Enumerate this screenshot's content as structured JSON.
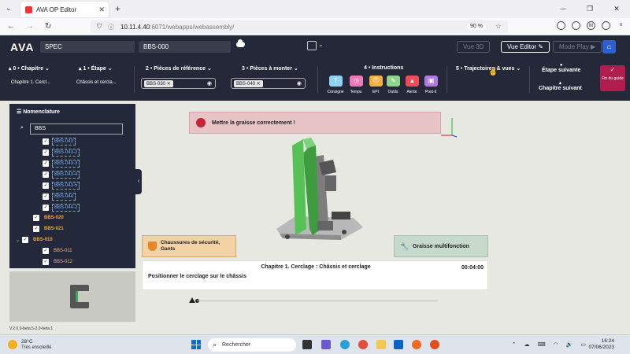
{
  "browser": {
    "tab_title": "AVA OP Editor",
    "url_host": "10.11.4.40",
    "url_rest": ":6071/webapps/webassembly/",
    "zoom": "90 %"
  },
  "app": {
    "logo": "AVA",
    "project_field": "SPEC",
    "assembly_field": "BBS-000",
    "views": {
      "vue3d": "Vue 3D",
      "editor": "Vue Editor",
      "play": "Mode Play"
    }
  },
  "toolbar": {
    "chapitre_label": "0 • Chapitre",
    "chapitre_value": "Chapitre 1. Cercl...",
    "etape_label": "1 • Étape",
    "etape_value": "Châssis et cercla...",
    "ref_label": "2 • Pièces de référence",
    "ref_chip": "BBS-030",
    "mount_label": "3 • Pièces à monter",
    "mount_chip": "BBS-040",
    "instructions_label": "4 • Instructions",
    "instructions": [
      {
        "label": "Consigne",
        "glyph": "T",
        "color": "#8fd3f4"
      },
      {
        "label": "Temps",
        "glyph": "◷",
        "color": "#f07ab8"
      },
      {
        "label": "EPI",
        "glyph": "⛑",
        "color": "#f5b042"
      },
      {
        "label": "Outils",
        "glyph": "✎",
        "color": "#8fd48a"
      },
      {
        "label": "Alerte",
        "glyph": "▲",
        "color": "#f04b5a"
      },
      {
        "label": "Post-it",
        "glyph": "▣",
        "color": "#b07ae0"
      }
    ],
    "traj_label": "5 • Trajectoires & vues",
    "next_step": "Étape suivante",
    "next_chapter": "Chapitre suivant",
    "fin_label": "Fin du guide"
  },
  "nomenclature": {
    "title": "Nomenclature",
    "search": "BBS",
    "items": [
      {
        "label": "BBS-043",
        "indent": 2,
        "style": "blue boxed",
        "check": true
      },
      {
        "label": "BBS-043-2",
        "indent": 2,
        "style": "blue boxed",
        "check": true
      },
      {
        "label": "BBS-043-3",
        "indent": 2,
        "style": "blue boxed",
        "check": true
      },
      {
        "label": "BBS-043-4",
        "indent": 2,
        "style": "blue boxed",
        "check": true
      },
      {
        "label": "BBS-043-5",
        "indent": 2,
        "style": "blue boxed",
        "check": true
      },
      {
        "label": "BBS-044",
        "indent": 2,
        "style": "blue boxed",
        "check": true
      },
      {
        "label": "BBS-044-2",
        "indent": 2,
        "style": "blue boxed",
        "check": true
      },
      {
        "label": "BBS-020",
        "indent": 1,
        "style": "orange",
        "check": true
      },
      {
        "label": "BBS-021",
        "indent": 1,
        "style": "orange",
        "check": true
      },
      {
        "label": "BBS-010",
        "indent": 0,
        "style": "orange",
        "check": true,
        "expander": true
      },
      {
        "label": "BBS-011",
        "indent": 2,
        "style": "lightorange",
        "check": true
      },
      {
        "label": "BBS-012",
        "indent": 2,
        "style": "lightorange",
        "check": true
      }
    ]
  },
  "alert": {
    "text": "Mettre la graisse correctement !"
  },
  "ppe": {
    "text": "Chaussures de sécurité, Gants"
  },
  "tool": {
    "text": "Graisse multifonction"
  },
  "info": {
    "title": "Chapitre 1. Cerclage : Châssis et cerclage",
    "time": "00:04:00",
    "body": "Positionner le cerclage sur le châssis"
  },
  "version": "V.2.0.0-beta.5-2.0-beta.1",
  "taskbar": {
    "temp": "28°C",
    "weather": "Très ensoleillé",
    "search_placeholder": "Rechercher",
    "time": "16:24",
    "date": "07/06/2023"
  }
}
